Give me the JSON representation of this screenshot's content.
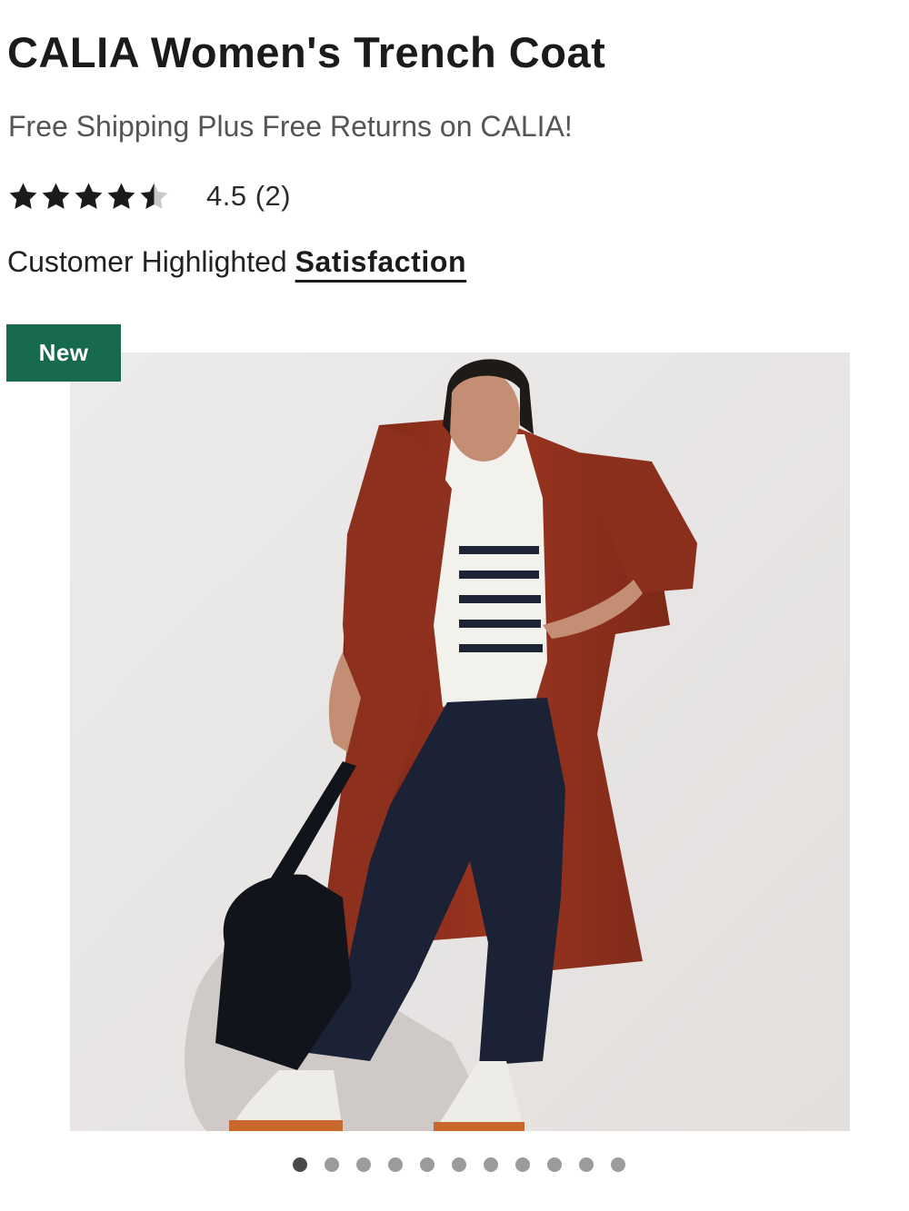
{
  "product": {
    "title": "CALIA Women's Trench Coat",
    "shipping_note": "Free Shipping Plus Free Returns on CALIA!",
    "rating": {
      "value": 4.5,
      "max": 5,
      "text": "4.5 (2)",
      "star_color": "#1b1b1b",
      "empty_star_color": "#c8c8c8"
    },
    "highlight": {
      "prefix": "Customer Highlighted ",
      "link_label": "Satisfaction"
    },
    "badge": {
      "label": "New",
      "color": "#17694f"
    },
    "image": {
      "description_icon": "product-photo",
      "coat_color": "#8c2f1c",
      "background_color": "#e9e6e5"
    },
    "carousel": {
      "total": 11,
      "active_index": 0
    }
  }
}
